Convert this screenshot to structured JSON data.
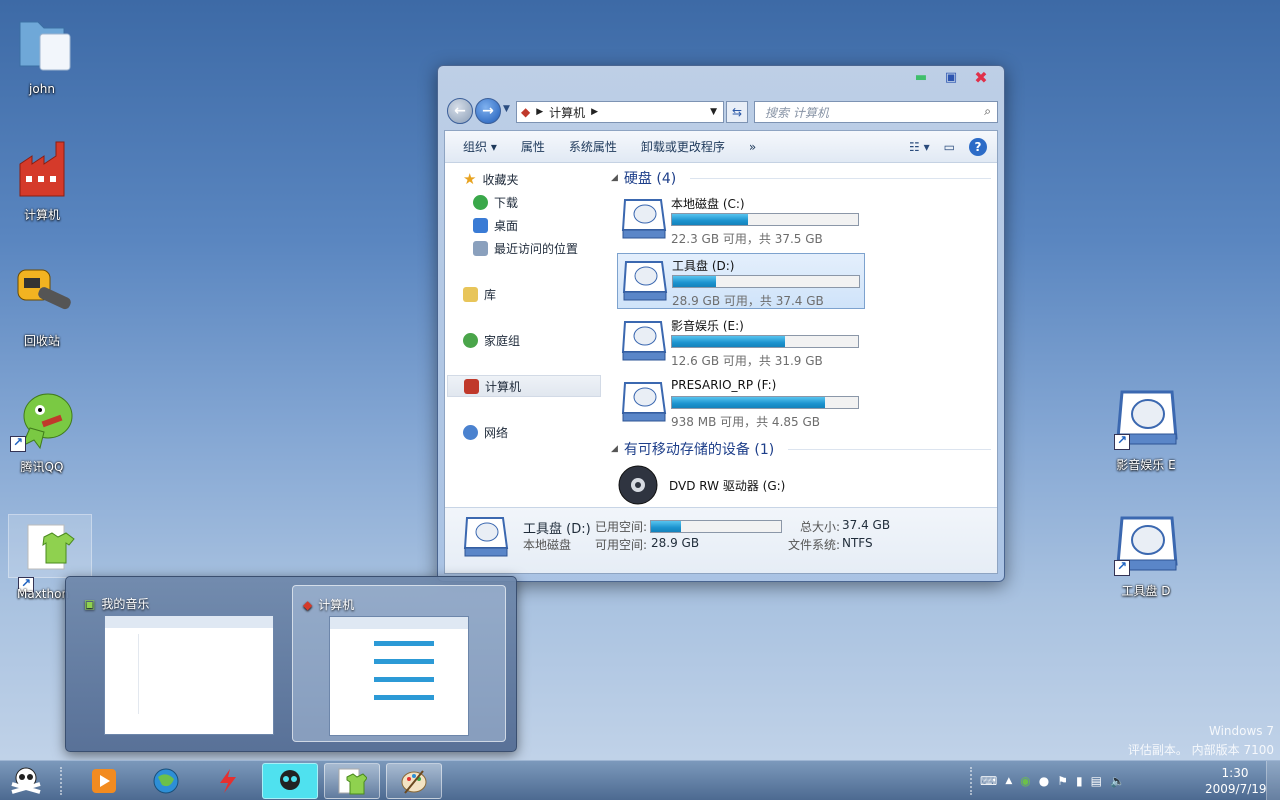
{
  "desktop": {
    "icons": [
      {
        "label": "john"
      },
      {
        "label": "计算机"
      },
      {
        "label": "回收站"
      },
      {
        "label": "腾讯QQ"
      },
      {
        "label": "Maxthon"
      },
      {
        "label": "影音娱乐 E"
      },
      {
        "label": "工具盘 D"
      }
    ]
  },
  "window": {
    "breadcrumb": "计算机",
    "search_placeholder": "搜索 计算机",
    "toolbar": [
      "组织",
      "属性",
      "系统属性",
      "卸载或更改程序",
      "»"
    ],
    "nav": {
      "favorites": "收藏夹",
      "downloads": "下载",
      "desktop": "桌面",
      "recent": "最近访问的位置",
      "libraries": "库",
      "homegroup": "家庭组",
      "computer": "计算机",
      "network": "网络"
    },
    "hdd_group": "硬盘 (4)",
    "removable_group": "有可移动存储的设备 (1)",
    "drives": [
      {
        "name": "本地磁盘 (C:)",
        "info": "22.3 GB 可用，共 37.5 GB",
        "used_fraction": 0.41
      },
      {
        "name": "工具盘 (D:)",
        "info": "28.9 GB 可用，共 37.4 GB",
        "used_fraction": 0.23
      },
      {
        "name": "影音娱乐 (E:)",
        "info": "12.6 GB 可用，共 31.9 GB",
        "used_fraction": 0.61
      },
      {
        "name": "PRESARIO_RP (F:)",
        "info": "938 MB 可用，共 4.85 GB",
        "used_fraction": 0.82
      }
    ],
    "dvd": "DVD RW 驱动器 (G:)",
    "details": {
      "name": "工具盘 (D:)",
      "type": "本地磁盘",
      "used_label": "已用空间:",
      "free_label": "可用空间:",
      "free_value": "28.9 GB",
      "total_label": "总大小:",
      "total_value": "37.4 GB",
      "fs_label": "文件系统:",
      "fs_value": "NTFS",
      "used_fraction": 0.23
    }
  },
  "thumbnails": [
    {
      "title": "我的音乐"
    },
    {
      "title": "计算机"
    }
  ],
  "taskbar": {
    "time": "1:30",
    "date": "2009/7/19"
  },
  "watermark": {
    "line1": "Windows 7",
    "line2": "评估副本。 内部版本 7100"
  }
}
